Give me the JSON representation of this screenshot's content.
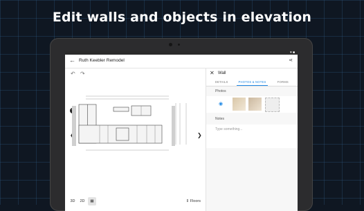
{
  "headline": "Edit walls and objects in elevation",
  "status": {
    "icons": "▾ ■"
  },
  "app_bar": {
    "back_glyph": "←",
    "project_title": "Ruth Keebler Remodel",
    "share_glyph": "⋖"
  },
  "canvas": {
    "undo_glyph": "↶",
    "redo_glyph": "↷",
    "add_glyph": "+",
    "prev_glyph": "❮",
    "next_glyph": "❯",
    "view_modes": [
      "3D",
      "2D",
      "▦"
    ],
    "active_view": "▦",
    "floors_label": "⇕ Floors"
  },
  "panel": {
    "close_glyph": "✕",
    "title": "Wall",
    "tabs": [
      "DETAILS",
      "PHOTOS & NOTES",
      "FORMS"
    ],
    "active_tab": "PHOTOS & NOTES",
    "photos_label": "Photos",
    "camera_glyph": "◉",
    "notes_label": "Notes",
    "notes_placeholder": "Type something..."
  },
  "colors": {
    "accent": "#1e88e5",
    "background": "#0f1722",
    "device": "#2c2c2e"
  }
}
